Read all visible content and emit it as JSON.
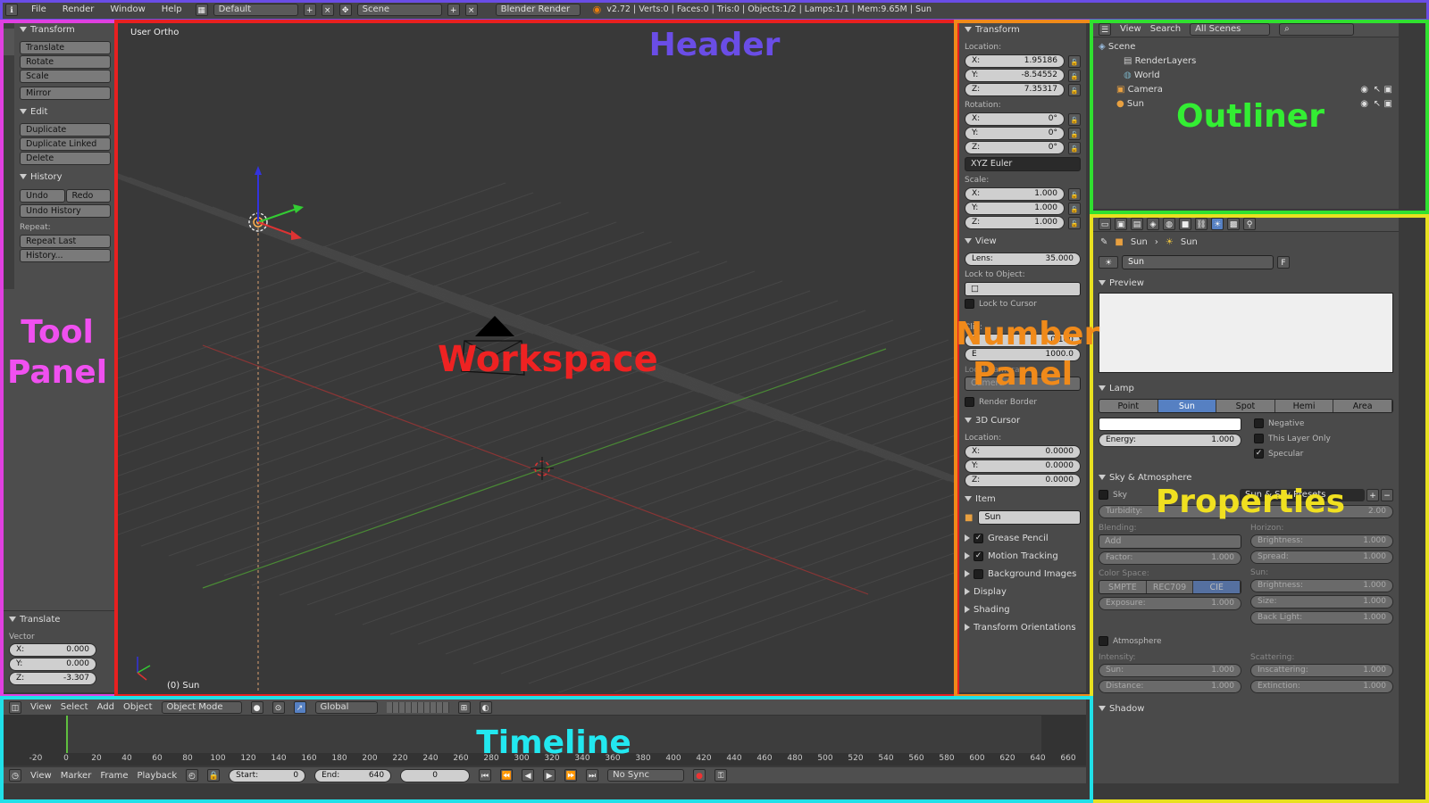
{
  "topbar": {
    "menus": [
      "File",
      "Render",
      "Window",
      "Help"
    ],
    "screen_layout": "Default",
    "scene": "Scene",
    "engine": "Blender Render",
    "stats": "v2.72 | Verts:0 | Faces:0 | Tris:0 | Objects:1/2 | Lamps:1/1 | Mem:9.65M | Sun"
  },
  "toolshelf": {
    "tabs": [
      "Tools",
      "Create",
      "Relations",
      "Animation",
      "Physics",
      "Grease Pencil"
    ],
    "transform": {
      "title": "Transform",
      "buttons": [
        "Translate",
        "Rotate",
        "Scale",
        "Mirror"
      ]
    },
    "edit": {
      "title": "Edit",
      "buttons": [
        "Duplicate",
        "Duplicate Linked",
        "Delete"
      ]
    },
    "history": {
      "title": "History",
      "undo": "Undo",
      "redo": "Redo",
      "undo_history": "Undo History",
      "repeat_label": "Repeat:",
      "repeat_last": "Repeat Last",
      "history_btn": "History..."
    },
    "operator": {
      "title": "Translate",
      "vector_label": "Vector",
      "x": "X:",
      "xv": "0.000",
      "y": "Y:",
      "yv": "0.000",
      "z": "Z:",
      "zv": "-3.307"
    }
  },
  "viewport": {
    "view_name": "User Ortho",
    "object_label": "(0) Sun"
  },
  "npanel": {
    "transform_title": "Transform",
    "location_label": "Location:",
    "loc": [
      {
        "a": "X:",
        "v": "1.95186"
      },
      {
        "a": "Y:",
        "v": "-8.54552"
      },
      {
        "a": "Z:",
        "v": "7.35317"
      }
    ],
    "rotation_label": "Rotation:",
    "rot": [
      {
        "a": "X:",
        "v": "0°"
      },
      {
        "a": "Y:",
        "v": "0°"
      },
      {
        "a": "Z:",
        "v": "0°"
      }
    ],
    "rotation_mode": "XYZ Euler",
    "scale_label": "Scale:",
    "scale": [
      {
        "a": "X:",
        "v": "1.000"
      },
      {
        "a": "Y:",
        "v": "1.000"
      },
      {
        "a": "Z:",
        "v": "1.000"
      }
    ],
    "view_title": "View",
    "lens_label": "Lens:",
    "lens": "35.000",
    "lock_obj": "Lock to Object:",
    "lock_cursor": "Lock to Cursor",
    "clip_label": "Clip:",
    "clip_start_label": "S",
    "clip_start": "0.100",
    "clip_end_label": "E",
    "clip_end": "1000.0",
    "local_camera": "Local Camera:",
    "camera": "Camera",
    "render_border": "Render Border",
    "cursor_title": "3D Cursor",
    "cursor_loc": "Location:",
    "cursor": [
      {
        "a": "X:",
        "v": "0.0000"
      },
      {
        "a": "Y:",
        "v": "0.0000"
      },
      {
        "a": "Z:",
        "v": "0.0000"
      }
    ],
    "item_title": "Item",
    "item_name": "Sun",
    "collapsed": [
      "Grease Pencil",
      "Motion Tracking",
      "Background Images",
      "Display",
      "Shading",
      "Transform Orientations"
    ]
  },
  "outliner": {
    "menu": [
      "View",
      "Search"
    ],
    "filter": "All Scenes",
    "tree": [
      "Scene",
      "RenderLayers",
      "World",
      "Camera",
      "Sun"
    ]
  },
  "properties": {
    "breadcrumb": [
      "Sun",
      "Sun"
    ],
    "datablock": "Sun",
    "fake": "F",
    "preview_title": "Preview",
    "lamp_title": "Lamp",
    "lamp_types": [
      "Point",
      "Sun",
      "Spot",
      "Hemi",
      "Area"
    ],
    "negative": "Negative",
    "this_layer": "This Layer Only",
    "specular": "Specular",
    "energy_label": "Energy:",
    "energy": "1.000",
    "sky_title": "Sky & Atmosphere",
    "sky": "Sky",
    "presets": "Sun & Sky Presets",
    "turbidity_label": "Turbidity:",
    "turbidity": "2.00",
    "blending": "Blending:",
    "blend_mode": "Add",
    "factor_label": "Factor:",
    "factor": "1.000",
    "horizon": "Horizon:",
    "brightness_label": "Brightness:",
    "brightness": "1.000",
    "spread_label": "Spread:",
    "spread": "1.000",
    "color_space": "Color Space:",
    "spaces": [
      "SMPTE",
      "REC709",
      "CIE"
    ],
    "exposure_label": "Exposure:",
    "exposure": "1.000",
    "sun_label": "Sun:",
    "sun_bright_label": "Brightness:",
    "sun_bright": "1.000",
    "size_label": "Size:",
    "size": "1.000",
    "back_light_label": "Back Light:",
    "back_light": "1.000",
    "atmosphere": "Atmosphere",
    "intensity": "Intensity:",
    "scattering": "Scattering:",
    "int_sun_label": "Sun:",
    "int_sun": "1.000",
    "distance_label": "Distance:",
    "distance": "1.000",
    "inscattering_label": "Inscattering:",
    "inscattering": "1.000",
    "extinction_label": "Extinction:",
    "extinction": "1.000",
    "shadow_title": "Shadow"
  },
  "viewheader": {
    "menus": [
      "View",
      "Select",
      "Add",
      "Object"
    ],
    "mode": "Object Mode",
    "orientation": "Global"
  },
  "timeline": {
    "ticks": [
      "-20",
      "0",
      "20",
      "40",
      "60",
      "80",
      "100",
      "120",
      "140",
      "160",
      "180",
      "200",
      "220",
      "240",
      "260",
      "280",
      "300",
      "320",
      "340",
      "360",
      "380",
      "400",
      "420",
      "440",
      "460",
      "480",
      "500",
      "520",
      "540",
      "560",
      "580",
      "600",
      "620",
      "640",
      "660"
    ],
    "menus": [
      "View",
      "Marker",
      "Frame",
      "Playback"
    ],
    "start_label": "Start:",
    "start": "0",
    "end_label": "End:",
    "end": "640",
    "current": "0",
    "sync": "No Sync"
  },
  "annotations": {
    "header": "Header",
    "tool_panel_1": "Tool",
    "tool_panel_2": "Panel",
    "workspace": "Workspace",
    "number_panel_1": "Number",
    "number_panel_2": "Panel",
    "outliner": "Outliner",
    "properties": "Properties",
    "timeline": "Timeline"
  }
}
